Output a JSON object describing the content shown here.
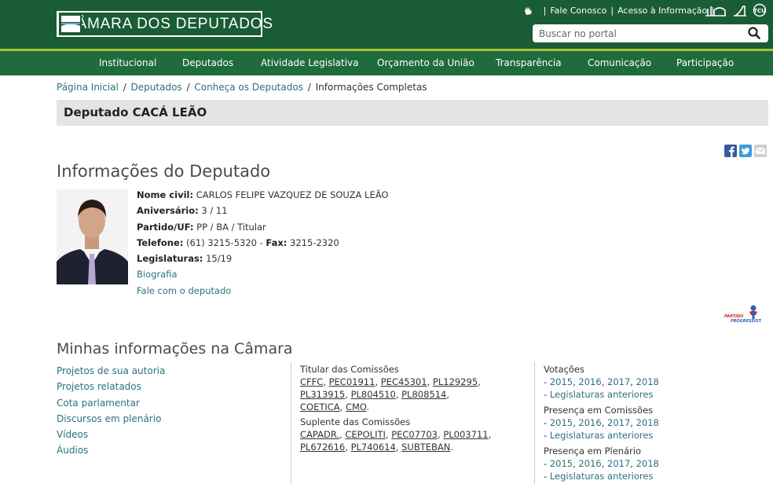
{
  "header": {
    "logo_text": "CÂMARA DOS DEPUTADOS",
    "top_links": [
      "Fale Conosco",
      "Acesso à Informação"
    ],
    "search_placeholder": "Buscar no portal",
    "tool_icons": [
      "libras-icon",
      "senado-icon",
      "stf-icon",
      "tcu-icon"
    ],
    "bg_color": "#1a5c36",
    "stripe_color": "#a5c33a"
  },
  "nav": {
    "items": [
      "Institucional",
      "Deputados",
      "Atividade Legislativa",
      "Orçamento da União",
      "Transparência",
      "Comunicação",
      "Participação"
    ]
  },
  "breadcrumb": {
    "items": [
      "Página Inicial",
      "Deputados",
      "Conheça os Deputados"
    ],
    "current": "Informações Completas"
  },
  "page_title": "Deputado CACÁ LEÃO",
  "share_icons": [
    "facebook-icon",
    "twitter-icon",
    "email-icon"
  ],
  "deputy": {
    "section_title": "Informações do Deputado",
    "fields": [
      {
        "label": "Nome civil:",
        "value": "CARLOS FELIPE VAZQUEZ DE SOUZA LEÃO"
      },
      {
        "label": "Aniversário:",
        "value": "3 / 11"
      },
      {
        "label": "Partido/UF:",
        "value": "PP / BA / Titular"
      },
      {
        "label": "Telefone:",
        "value": "(61) 3215-5320 - ",
        "label2": "Fax:",
        "value2": "3215-2320"
      },
      {
        "label": "Legislaturas:",
        "value": "15/19"
      }
    ],
    "links": [
      "Biografia",
      "Fale com o deputado"
    ],
    "party_logo_text": "PARTIDO PROGRESSISTA"
  },
  "minhas": {
    "title": "Minhas informações na Câmara",
    "links": [
      "Projetos de sua autoria",
      "Projetos relatados",
      "Cota parlamentar",
      "Discursos em plenário",
      "Vídeos",
      "Áudios"
    ],
    "titular_label": "Titular das Comissões",
    "titular": [
      "CFFC",
      "PEC01911",
      "PEC45301",
      "PL129295",
      "PL313915",
      "PL804510",
      "PL808514",
      "COETICA",
      "CMO"
    ],
    "suplente_label": "Suplente das Comissões",
    "suplente": [
      "CAPADR.",
      "CEPOLITI",
      "PEC07703",
      "PL003711",
      "PL672616",
      "PL740614",
      "SUBTEBAN"
    ],
    "stats": [
      {
        "label": "Votações",
        "years": [
          "2015",
          "2016",
          "2017",
          "2018"
        ],
        "anteriores": "Legislaturas anteriores"
      },
      {
        "label": "Presença em Comissões",
        "years": [
          "2015",
          "2016",
          "2017",
          "2018"
        ],
        "anteriores": "Legislaturas anteriores"
      },
      {
        "label": "Presença em Plenário",
        "years": [
          "2015",
          "2016",
          "2017",
          "2018"
        ],
        "anteriores": "Legislaturas anteriores"
      }
    ]
  }
}
